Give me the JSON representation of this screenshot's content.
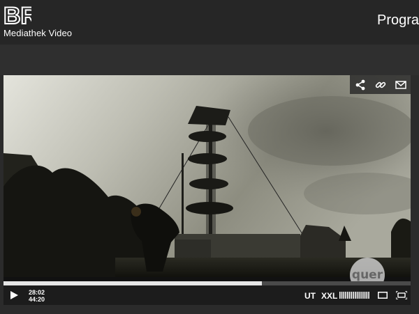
{
  "header": {
    "logo_text": "BR",
    "subtitle": "Mediathek Video",
    "nav_partial": "Progra"
  },
  "player": {
    "share_icons": [
      "share-icon",
      "link-icon",
      "mail-icon"
    ],
    "watermark": "quer",
    "progress_fraction": 0.634,
    "current_time": "28:02",
    "duration": "44:20",
    "subtitle_button": "UT",
    "size_button": "XXL",
    "volume_fraction": 1.0
  },
  "colors": {
    "header_bg": "#262626",
    "page_bg": "#2b2b2b",
    "progress_fill": "#e6e6e6"
  }
}
